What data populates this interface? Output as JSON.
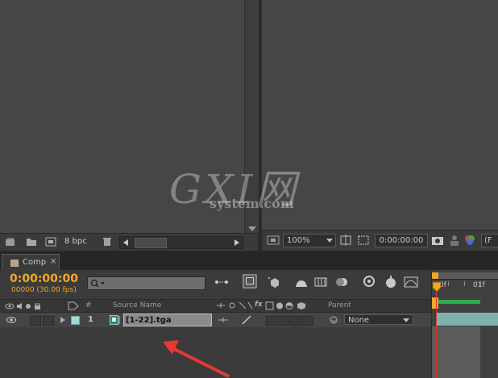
{
  "project_panel": {
    "footer": {
      "bit_depth": "8 bpc"
    }
  },
  "viewer": {
    "zoom": "100%",
    "timecode": "0:00:00:00",
    "resolution_partial": "(F"
  },
  "watermark": {
    "main": "GXI网",
    "sub": "system.com"
  },
  "timeline": {
    "tab": {
      "label": "Comp",
      "close": "×"
    },
    "current_time": "0:00:00:00",
    "frame_info": "00000 (30.00 fps)",
    "search_placeholder": "",
    "columns": {
      "number": "#",
      "source_name": "Source Name",
      "parent": "Parent",
      "fx": "fx"
    },
    "ruler": {
      "start": "0f",
      "mark": "01f"
    },
    "layers": [
      {
        "index": "1",
        "name": "[1-22].tga",
        "parent": "None"
      }
    ]
  },
  "colors": {
    "accent": "#f0a824",
    "panel": "#464646",
    "annotation_arrow": "#e53a30",
    "work_area": "#2fa84f",
    "playhead": "#d33b2a"
  }
}
